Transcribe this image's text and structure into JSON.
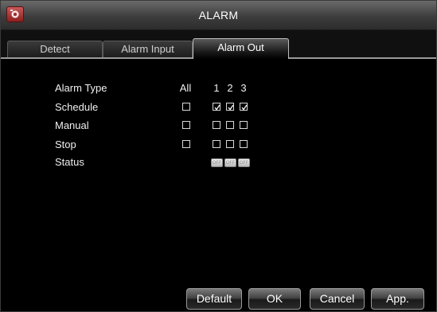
{
  "window": {
    "title": "ALARM"
  },
  "tabs": [
    {
      "label": "Detect",
      "active": false
    },
    {
      "label": "Alarm Input",
      "active": false
    },
    {
      "label": "Alarm Out",
      "active": true
    }
  ],
  "grid": {
    "row_header": "Alarm Type",
    "columns": [
      "All",
      "1",
      "2",
      "3"
    ],
    "rows": [
      {
        "label": "Schedule",
        "all": false,
        "checks": [
          true,
          true,
          true
        ]
      },
      {
        "label": "Manual",
        "all": false,
        "checks": [
          false,
          false,
          false
        ]
      },
      {
        "label": "Stop",
        "all": false,
        "checks": [
          false,
          false,
          false
        ]
      }
    ],
    "status": {
      "label": "Status",
      "values": [
        "OFF",
        "OFF",
        "OFF"
      ]
    }
  },
  "buttons": {
    "default_label": "Default",
    "ok_label": "OK",
    "cancel_label": "Cancel",
    "apply_label": "App."
  },
  "colors": {
    "background": "#000000",
    "titlebar": "#4a4a4a",
    "text": "#f0f0f0"
  },
  "icons": {
    "title_icon": "camera-alarm-icon",
    "check": "checkmark-icon"
  }
}
